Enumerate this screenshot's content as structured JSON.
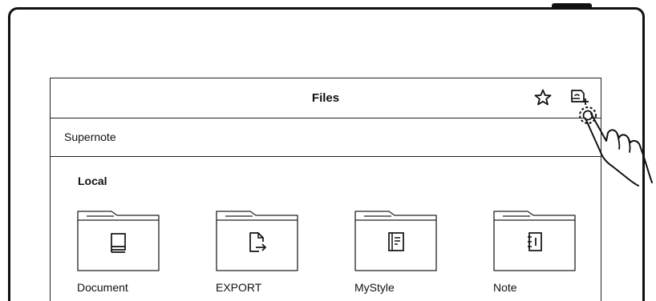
{
  "header": {
    "title": "Files",
    "icons": [
      "star-icon",
      "add-storage-icon"
    ]
  },
  "breadcrumb": "Supernote",
  "section": {
    "label": "Local"
  },
  "folders": [
    {
      "label": "Document",
      "icon": "book-icon"
    },
    {
      "label": "EXPORT",
      "icon": "export-file-icon"
    },
    {
      "label": "MyStyle",
      "icon": "template-icon"
    },
    {
      "label": "Note",
      "icon": "notebook-icon"
    }
  ]
}
